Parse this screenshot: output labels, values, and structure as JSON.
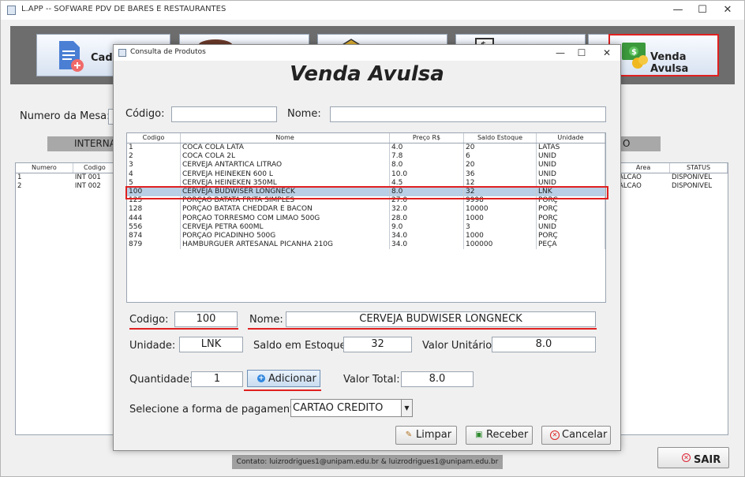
{
  "main_window": {
    "title": "L.APP -- SOFWARE PDV DE BARES E RESTAURANTES",
    "nav": {
      "cadastro_label": "Cadast",
      "venda_avulsa_label": "Venda Avulsa"
    },
    "mesa_label": "Numero da Mesa:",
    "internas_header": "INTERNA",
    "right_header": "O",
    "left_table": {
      "columns": [
        "Numero",
        "Codigo"
      ],
      "rows": [
        [
          "1",
          "INT 001"
        ],
        [
          "2",
          "INT 002"
        ]
      ]
    },
    "right_table": {
      "columns": [
        "Area",
        "STATUS"
      ],
      "rows": [
        [
          "ALCÃO",
          "DISPONIVEL"
        ],
        [
          "ALCÃO",
          "DISPONIVEL"
        ]
      ]
    },
    "contact": "Contato: luizrodrigues1@unipam.edu.br & luizrodrigues1@unipam.edu.br",
    "sair_label": "SAIR"
  },
  "dialog": {
    "title": "Consulta de Produtos",
    "heading": "Venda Avulsa",
    "search": {
      "codigo_label": "Código:",
      "codigo_value": "",
      "nome_label": "Nome:",
      "nome_value": ""
    },
    "table": {
      "columns": [
        "Codigo",
        "Nome",
        "Preço R$",
        "Saldo Estoque",
        "Unidade"
      ],
      "rows": [
        [
          "1",
          "COCA COLA LATA",
          "4.0",
          "20",
          "LATAS"
        ],
        [
          "2",
          "COCA COLA 2L",
          "7.8",
          "6",
          "UNID"
        ],
        [
          "3",
          "CERVEJA ANTARTICA LITRAO",
          "8.0",
          "20",
          "UNID"
        ],
        [
          "4",
          "CERVEJA HEINEKEN 600 L",
          "10.0",
          "36",
          "UNID"
        ],
        [
          "5",
          "CERVEJA HEINEKEN 350ML",
          "4.5",
          "12",
          "UNID"
        ],
        [
          "100",
          "CERVEJA BUDWISER LONGNECK",
          "8.0",
          "32",
          "LNK"
        ],
        [
          "125",
          "PORÇAO BATATA FRITA SIMPLES",
          "27.0",
          "9998",
          "PORÇ"
        ],
        [
          "128",
          "PORÇAO BATATA CHEDDAR E BACON",
          "32.0",
          "10000",
          "PORÇ"
        ],
        [
          "444",
          "PORÇAO TORRESMO COM LIMAO 500G",
          "28.0",
          "1000",
          "PORÇ"
        ],
        [
          "556",
          "CERVEJA PETRA 600ML",
          "9.0",
          "3",
          "UNID"
        ],
        [
          "874",
          "PORÇAO PICADINHO 500G",
          "34.0",
          "1000",
          "PORÇ"
        ],
        [
          "879",
          "HAMBURGUER ARTESANAL PICANHA 210G",
          "34.0",
          "100000",
          "PEÇA"
        ]
      ],
      "selected_index": 5
    },
    "form": {
      "codigo_label": "Codigo:",
      "codigo_value": "100",
      "nome_label": "Nome:",
      "nome_value": "CERVEJA BUDWISER LONGNECK",
      "unidade_label": "Unidade:",
      "unidade_value": "LNK",
      "saldo_label": "Saldo em Estoque:",
      "saldo_value": "32",
      "valor_unitario_label": "Valor Unitário:",
      "valor_unitario_value": "8.0",
      "quantidade_label": "Quantidade:",
      "quantidade_value": "1",
      "adicionar_label": "Adicionar",
      "valor_total_label": "Valor Total:",
      "valor_total_value": "8.0",
      "pagamento_label": "Selecione a forma de pagamento:",
      "pagamento_value": "CARTAO CREDITO"
    },
    "buttons": {
      "limpar": "Limpar",
      "receber": "Receber",
      "cancelar": "Cancelar"
    }
  },
  "colors": {
    "highlight_red": "#e02020",
    "selected_row": "#b8cfe5",
    "banner_gray": "#6d6d6d"
  }
}
